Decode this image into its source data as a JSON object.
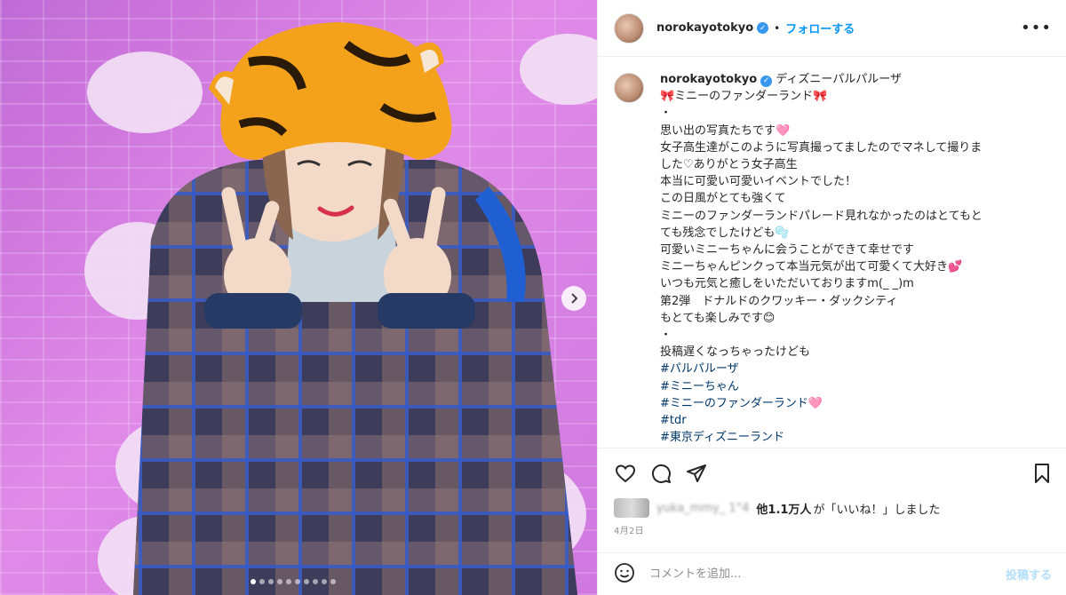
{
  "header": {
    "username": "norokayotokyo",
    "separator": "•",
    "follow_label": "フォローする",
    "more_icon": "more-horizontal-icon"
  },
  "caption": {
    "username": "norokayotokyo",
    "lines": [
      "ディズニーパルパルーザ",
      "🎀ミニーのファンダーランド🎀",
      "・",
      "思い出の写真たちです🩷",
      "女子高生達がこのように写真撮ってましたのでマネして撮りま",
      "した♡ありがとう女子高生",
      "本当に可愛い可愛いイベントでした！",
      "この日風がとても強くて",
      "ミニーのファンダーランドパレード見れなかったのはとてもと",
      "ても残念でしたけども🫧",
      "可愛いミニーちゃんに会うことができて幸せです",
      "ミニーちゃんピンクって本当元気が出て可愛くて大好き💕",
      "いつも元気と癒しをいただいておりますm(_ _)m",
      "第2弾　ドナルドのクワッキー・ダックシティ",
      "もとても楽しみです😊",
      "・",
      "投稿遅くなっちゃったけども"
    ],
    "hashtags": [
      "#パルパルーザ",
      "#ミニーちゃん",
      "#ミニーのファンダーランド🩷",
      "#tdr",
      "#東京ディズニーランド"
    ]
  },
  "likes": {
    "blurred_names": "yuka_mmy_ 1°4",
    "count_text": "他1.1万人",
    "suffix_text": "が「いいね！」しました",
    "date": "4月2日"
  },
  "comment": {
    "placeholder": "コメントを追加...",
    "post_label": "投稿する"
  },
  "carousel": {
    "total": 10,
    "active": 0
  },
  "colors": {
    "accent": "#0095f6",
    "hashtag": "#00376b",
    "post_disabled": "#b2dffc",
    "photo_bg": "#d67fe0"
  }
}
